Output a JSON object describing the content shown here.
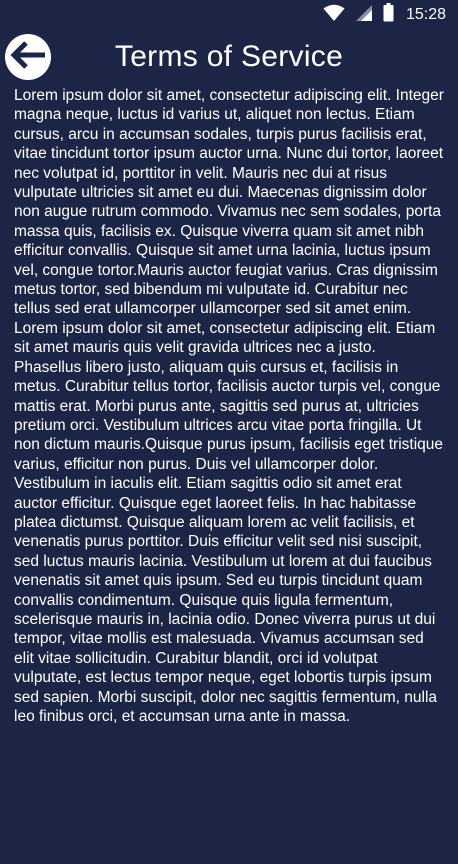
{
  "status_bar": {
    "icons": [
      "wifi-icon",
      "signal-icon",
      "battery-icon"
    ],
    "time": "15:28"
  },
  "app_bar": {
    "back_icon": "arrow-left-icon",
    "title": "Terms of Service"
  },
  "body_text": "Lorem ipsum dolor sit amet, consectetur adipiscing elit. Integer magna neque, luctus id varius ut, aliquet non lectus. Etiam cursus, arcu in accumsan sodales, turpis purus facilisis erat, vitae tincidunt tortor ipsum auctor urna. Nunc dui tortor, laoreet nec volutpat id, porttitor in velit. Mauris nec dui at risus vulputate ultricies sit amet eu dui. Maecenas dignissim dolor non augue rutrum commodo. Vivamus nec sem sodales, porta massa quis, facilisis ex. Quisque viverra quam sit amet nibh efficitur convallis. Quisque sit amet urna lacinia, luctus ipsum vel, congue tortor.Mauris auctor feugiat varius. Cras dignissim metus tortor, sed bibendum mi vulputate id. Curabitur nec tellus sed erat ullamcorper ullamcorper sed sit amet enim. Lorem ipsum dolor sit amet, consectetur adipiscing elit. Etiam sit amet mauris quis velit gravida ultrices nec a justo. Phasellus libero justo, aliquam quis cursus et, facilisis in metus. Curabitur tellus tortor, facilisis auctor turpis vel, congue mattis erat. Morbi purus ante, sagittis sed purus at, ultricies pretium orci. Vestibulum ultrices arcu vitae porta fringilla. Ut non dictum mauris.Quisque purus ipsum, facilisis eget tristique varius, efficitur non purus. Duis vel ullamcorper dolor. Vestibulum in iaculis elit. Etiam sagittis odio sit amet erat auctor efficitur. Quisque eget laoreet felis. In hac habitasse platea dictumst. Quisque aliquam lorem ac velit facilisis, et venenatis purus porttitor. Duis efficitur velit sed nisi suscipit, sed luctus mauris lacinia. Vestibulum ut lorem at dui faucibus venenatis sit amet quis ipsum. Sed eu turpis tincidunt quam convallis condimentum. Quisque quis ligula fermentum, scelerisque mauris in, lacinia odio. Donec viverra purus ut dui tempor, vitae mollis est malesuada. Vivamus accumsan sed elit vitae sollicitudin. Curabitur blandit, orci id volutpat vulputate, est lectus tempor neque, eget lobortis turpis ipsum sed sapien. Morbi suscipit, dolor nec sagittis fermentum, nulla leo finibus orci, et accumsan urna ante in massa.",
  "colors": {
    "background": "#1d2547",
    "text": "#ffffff",
    "back_button_bg": "#ffffff",
    "back_arrow": "#1d2547"
  }
}
